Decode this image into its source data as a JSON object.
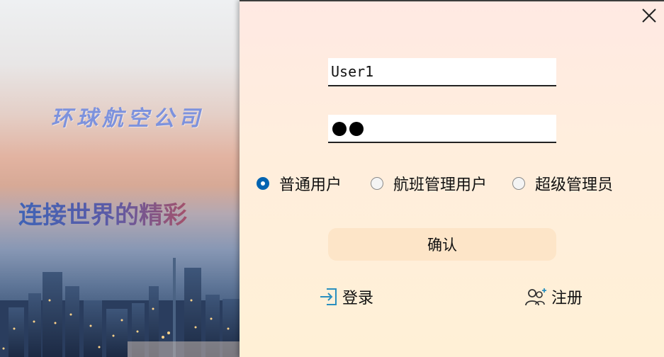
{
  "brand": {
    "company": "环球航空公司",
    "slogan": "连接世界的精彩"
  },
  "form": {
    "username_value": "User1",
    "password_masked_count": 2
  },
  "user_types": [
    {
      "label": "普通用户",
      "checked": true
    },
    {
      "label": "航班管理用户",
      "checked": false
    },
    {
      "label": "超级管理员",
      "checked": false
    }
  ],
  "actions": {
    "confirm_label": "确认",
    "login_label": "登录",
    "register_label": "注册"
  },
  "icons": {
    "close": "close-icon",
    "login": "login-icon",
    "register": "add-user-icon"
  },
  "colors": {
    "accent": "#0063b1",
    "confirm_bg": "#fde5c8",
    "icon_blue": "#2a8fbf"
  }
}
